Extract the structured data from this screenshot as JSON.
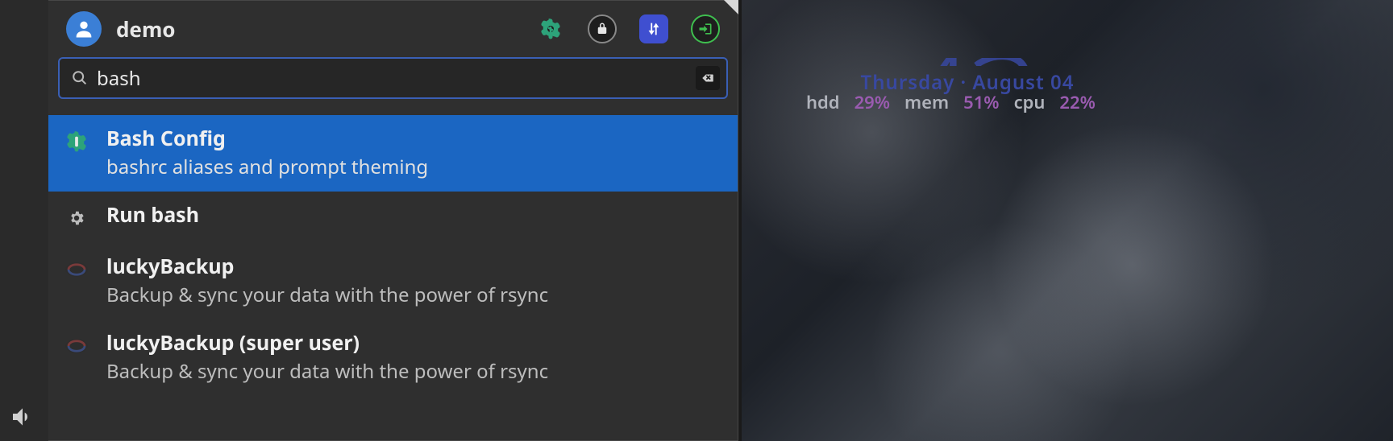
{
  "header": {
    "username": "demo"
  },
  "search": {
    "query": "bash",
    "placeholder": ""
  },
  "results": [
    {
      "icon": "settings-wrench-icon",
      "title": "Bash Config",
      "desc": "bashrc aliases and prompt theming",
      "selected": true
    },
    {
      "icon": "gear-icon",
      "title": "Run bash",
      "desc": "",
      "selected": false
    },
    {
      "icon": "sync-icon",
      "title": "luckyBackup",
      "desc": "Backup & sync your data with the power of rsync",
      "selected": false
    },
    {
      "icon": "sync-icon",
      "title": "luckyBackup (super user)",
      "desc": "Backup & sync your data with the power of rsync",
      "selected": false
    }
  ],
  "desktop": {
    "date": "Thursday · August 04",
    "stats": {
      "hdd_label": "hdd",
      "hdd_value": "29%",
      "mem_label": "mem",
      "mem_value": "51%",
      "cpu_label": "cpu",
      "cpu_value": "22%"
    }
  }
}
